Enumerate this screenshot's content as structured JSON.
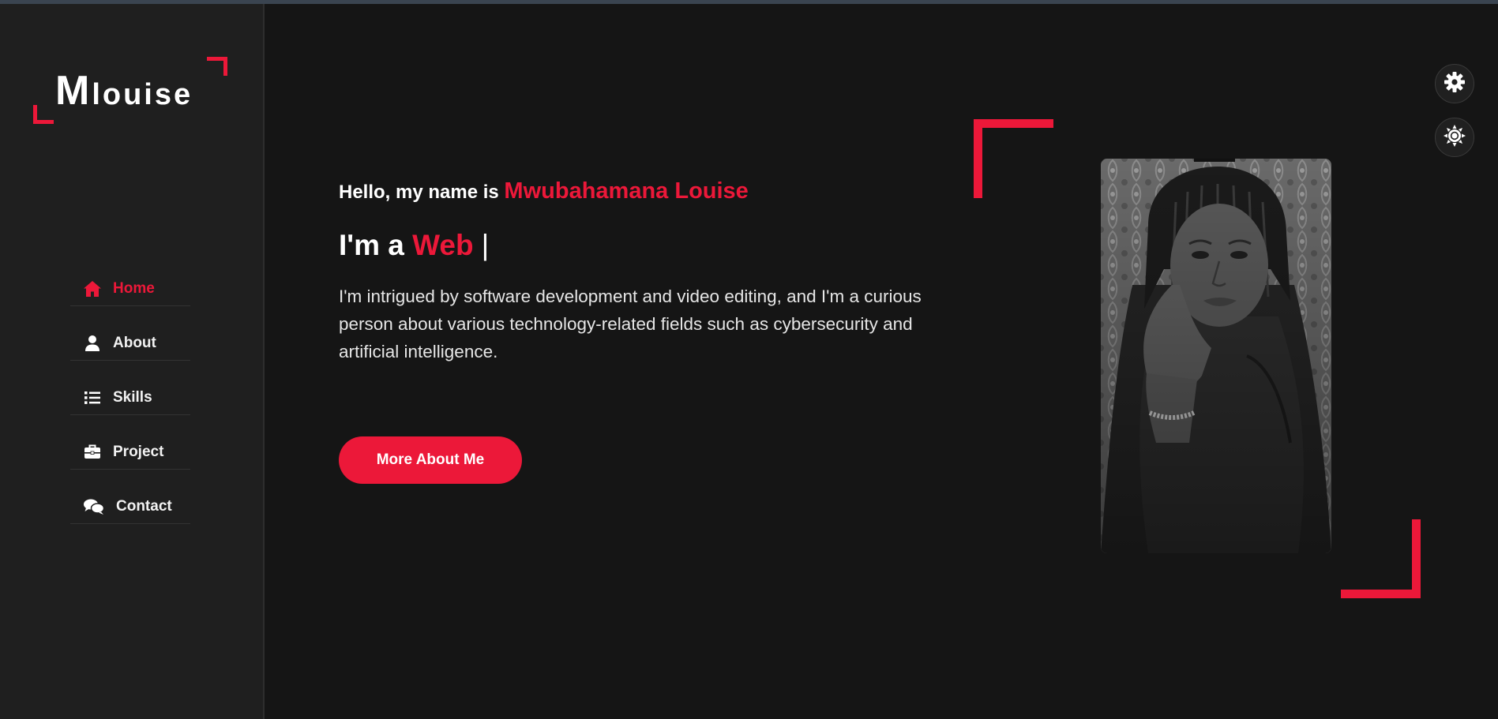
{
  "logo": {
    "initial": "M",
    "rest": "louise"
  },
  "nav": {
    "items": [
      {
        "label": "Home",
        "icon": "home-icon",
        "active": true
      },
      {
        "label": "About",
        "icon": "user-icon",
        "active": false
      },
      {
        "label": "Skills",
        "icon": "list-icon",
        "active": false
      },
      {
        "label": "Project",
        "icon": "briefcase-icon",
        "active": false
      },
      {
        "label": "Contact",
        "icon": "chat-icon",
        "active": false
      }
    ]
  },
  "hero": {
    "greeting": "Hello, my name is",
    "name": "Mwubahamana Louise",
    "role_prefix": "I'm a",
    "role_word": "Web",
    "caret": "|",
    "intro": "I'm intrigued by software development and video editing, and I'm a curious person about various technology-related fields such as cybersecurity and artificial intelligence.",
    "button_label": "More About Me"
  },
  "settings": {
    "buttons": [
      {
        "icon": "gear-icon"
      },
      {
        "icon": "sun-icon"
      }
    ]
  },
  "colors": {
    "accent": "#ec1839",
    "background": "#151515",
    "sidebar": "#1f1f1f"
  }
}
